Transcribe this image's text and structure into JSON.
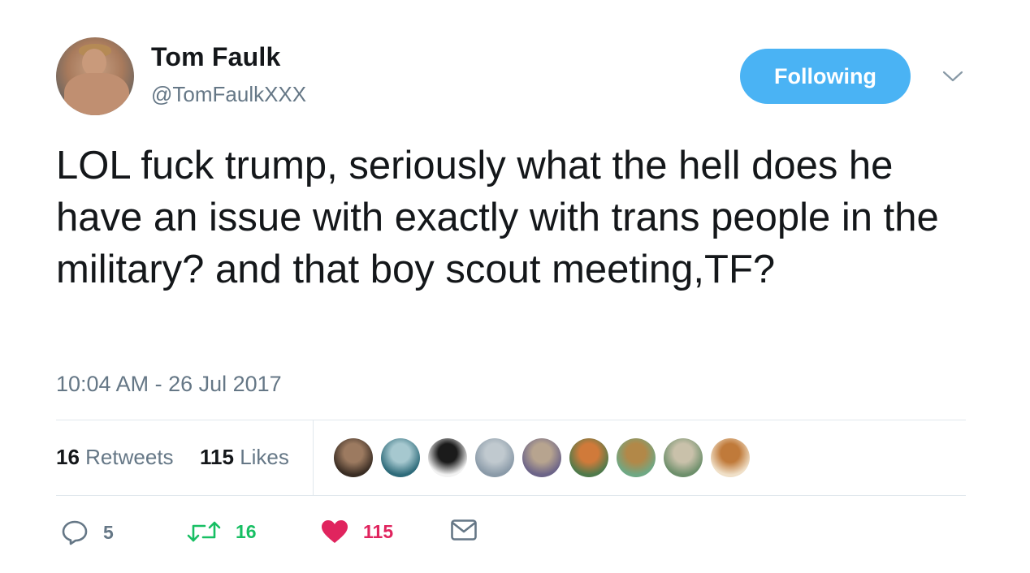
{
  "user": {
    "name": "Tom Faulk",
    "handle": "@TomFaulkXXX"
  },
  "follow_button": {
    "label": "Following"
  },
  "tweet": {
    "text": "LOL fuck trump, seriously what the hell does he have an issue with exactly with trans people in the military? and that boy scout meeting,TF?",
    "timestamp": "10:04 AM - 26 Jul 2017"
  },
  "stats": {
    "retweets_count": "16",
    "retweets_label": "Retweets",
    "likes_count": "115",
    "likes_label": "Likes"
  },
  "likers": [
    {
      "colors": [
        "#3a2d24",
        "#9c7a60"
      ]
    },
    {
      "colors": [
        "#2e6b7a",
        "#a6c8cf"
      ]
    },
    {
      "colors": [
        "#f2f2f2",
        "#1b1b1b"
      ]
    },
    {
      "colors": [
        "#8a9aa8",
        "#c0c9cf"
      ]
    },
    {
      "colors": [
        "#6c6488",
        "#b7a48f"
      ]
    },
    {
      "colors": [
        "#4f7a4b",
        "#d07a3a"
      ]
    },
    {
      "colors": [
        "#6fa884",
        "#b28848"
      ]
    },
    {
      "colors": [
        "#6d8f6b",
        "#c9c1aa"
      ]
    },
    {
      "colors": [
        "#f0e0c8",
        "#c07a3a"
      ]
    }
  ],
  "actions": {
    "reply_count": "5",
    "retweet_count": "16",
    "like_count": "115"
  },
  "colors": {
    "accent": "#4ab3f4",
    "retweet": "#17bf63",
    "like": "#e0245e",
    "muted": "#657786"
  }
}
